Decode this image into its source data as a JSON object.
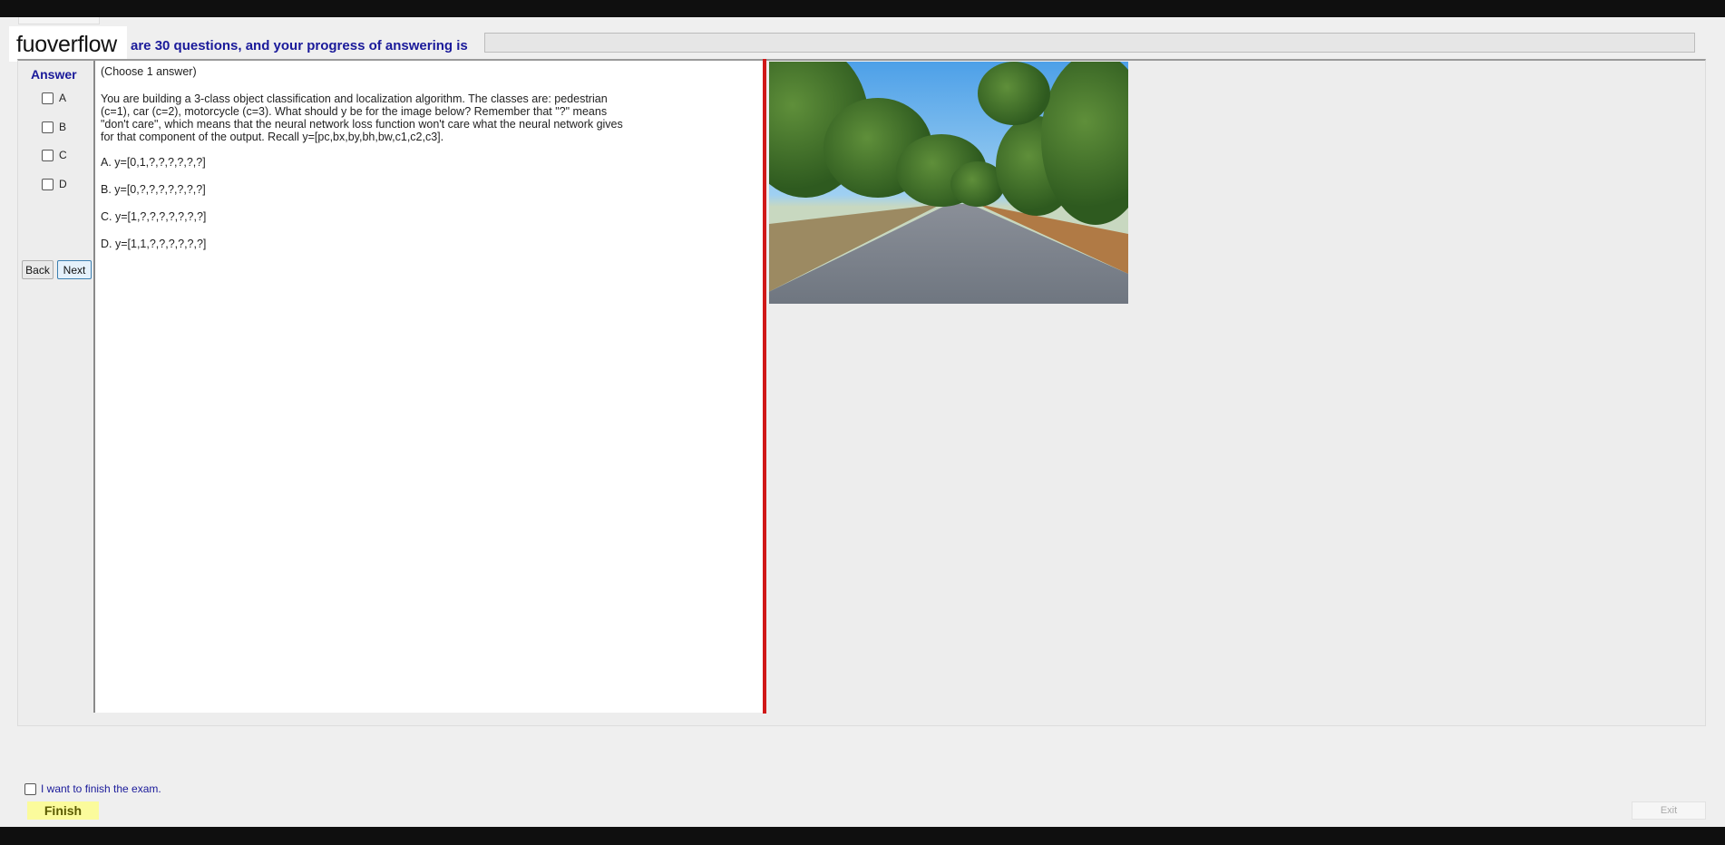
{
  "logo": "fuoverflow",
  "header": {
    "text": "are 30 questions, and your progress of answering is",
    "progress_percent": 0
  },
  "answer": {
    "label": "Answer",
    "options": [
      "A",
      "B",
      "C",
      "D"
    ]
  },
  "nav": {
    "back": "Back",
    "next": "Next"
  },
  "question": {
    "instruction": "(Choose 1 answer)",
    "body": "You are building a 3-class object classification and localization algorithm. The classes are: pedestrian (c=1), car (c=2), motorcycle (c=3). What should y be for the image below? Remember that \"?\" means \"don't care\", which means that the neural network loss function won't care what the neural network gives for that component of the output. Recall y=[pc,bx,by,bh,bw,c1,c2,c3].",
    "choices": [
      "A. y=[0,1,?,?,?,?,?,?]",
      "B. y=[0,?,?,?,?,?,?,?]",
      "C. y=[1,?,?,?,?,?,?,?]",
      "D. y=[1,1,?,?,?,?,?,?]"
    ]
  },
  "footer": {
    "finish_checkbox": "I want to finish the exam.",
    "finish": "Finish",
    "exit": "Exit"
  }
}
